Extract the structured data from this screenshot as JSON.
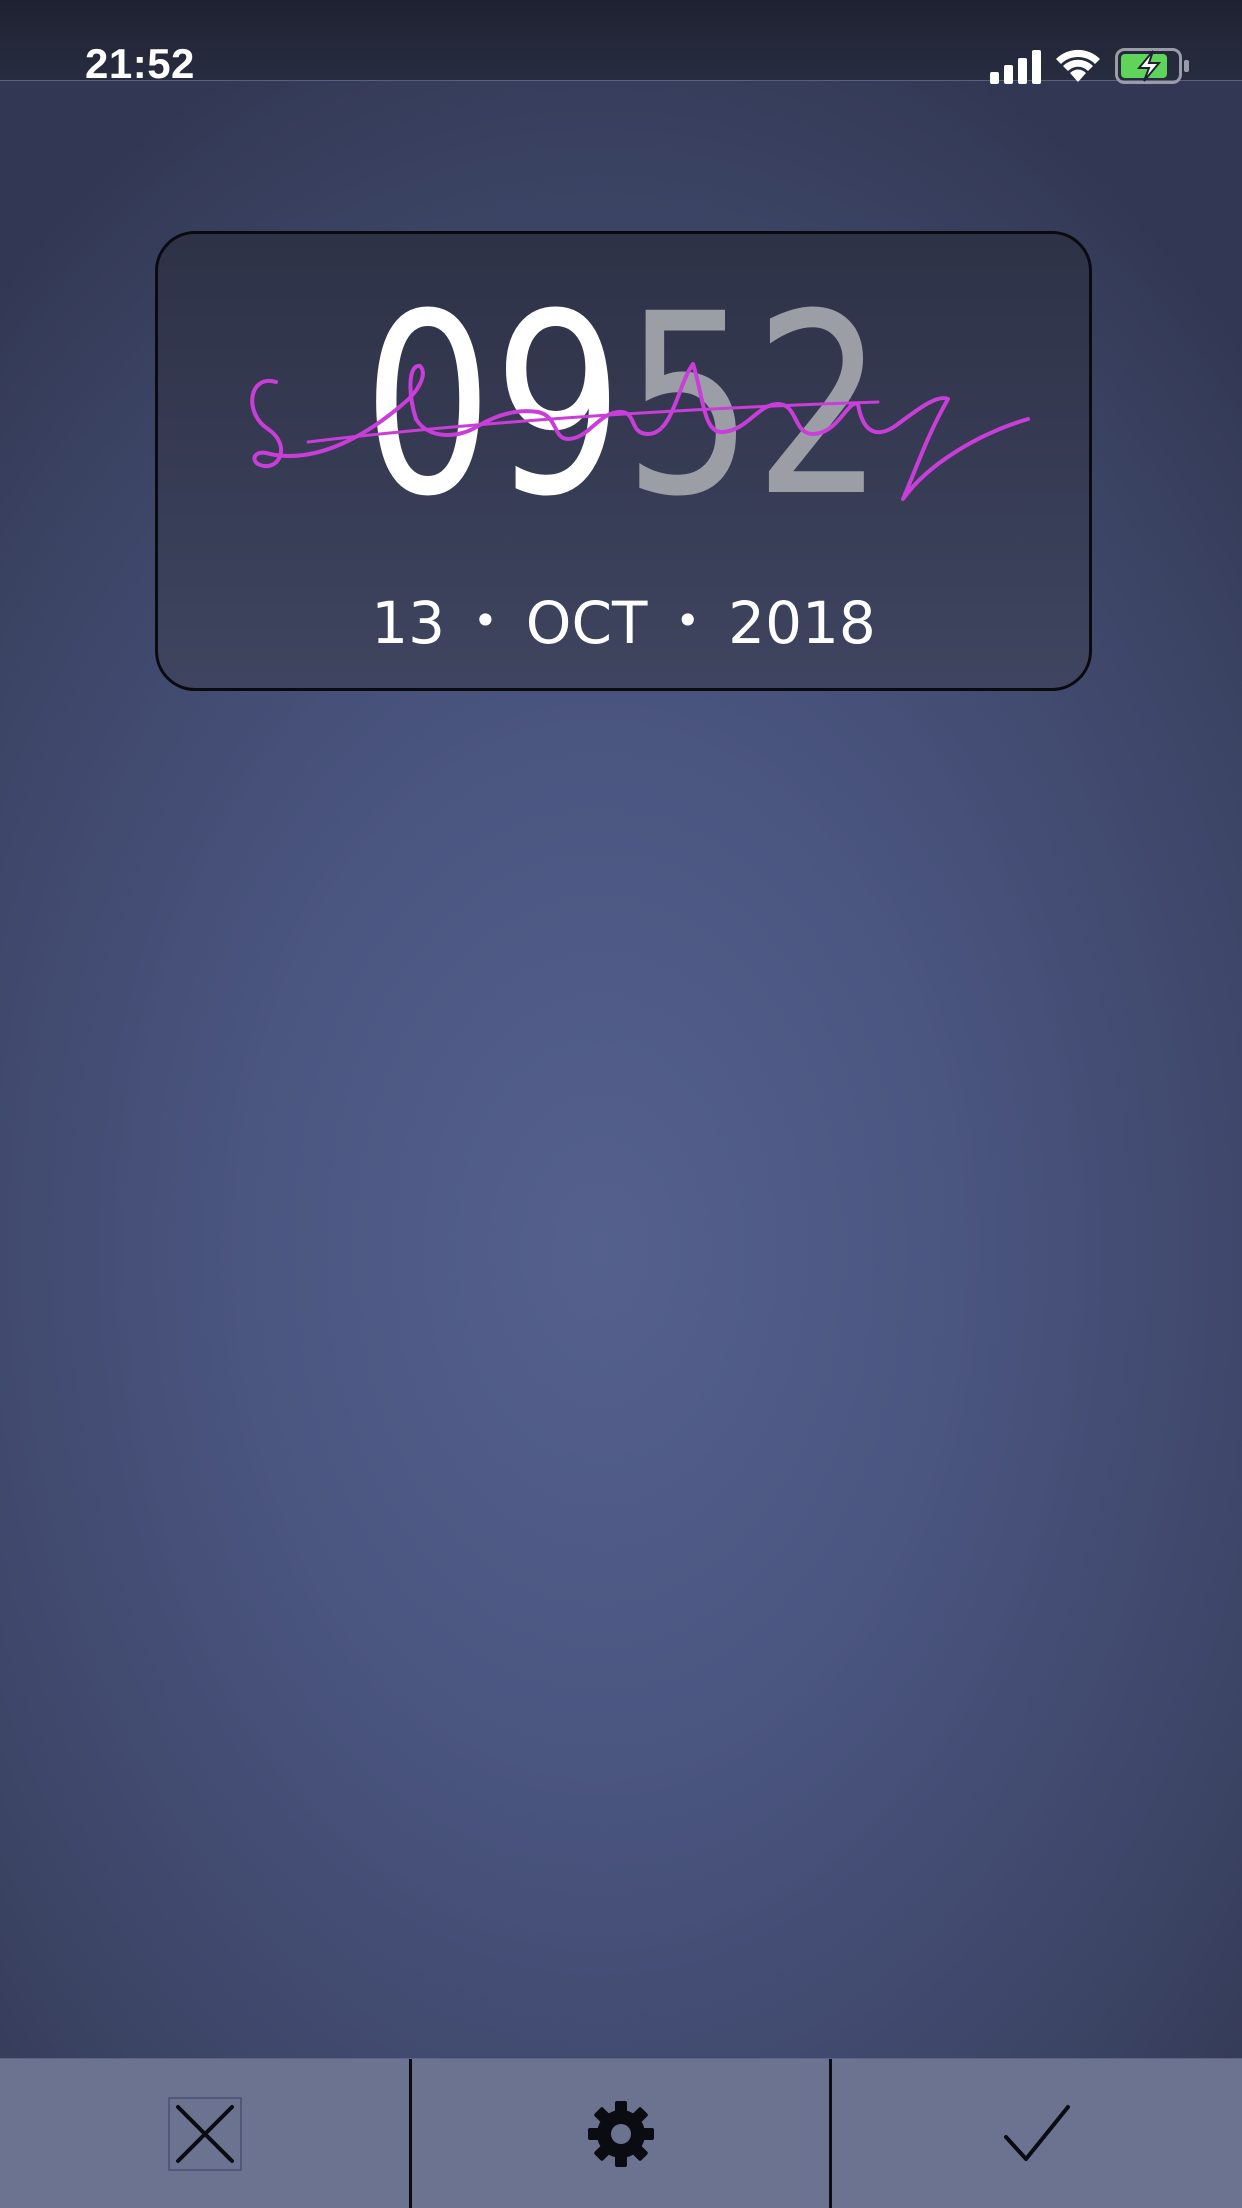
{
  "status_bar": {
    "time": "21:52",
    "icons": [
      "cellular-signal-icon",
      "wifi-icon",
      "battery-charging-icon"
    ],
    "battery_color": "#5fd35a"
  },
  "widget": {
    "hours": "09",
    "minutes": "52",
    "day_script": "Saturday",
    "day_script_color": "#c93ed8",
    "date": {
      "day": "13",
      "separator": "•",
      "month": "OCT",
      "year": "2018"
    }
  },
  "toolbar": {
    "buttons": [
      {
        "name": "cancel",
        "icon": "close-icon"
      },
      {
        "name": "settings",
        "icon": "gear-icon"
      },
      {
        "name": "confirm",
        "icon": "checkmark-icon"
      }
    ]
  },
  "colors": {
    "background": "#4a5580",
    "toolbar": "#6b7391",
    "minutes_gray": "#9c9ea6"
  }
}
